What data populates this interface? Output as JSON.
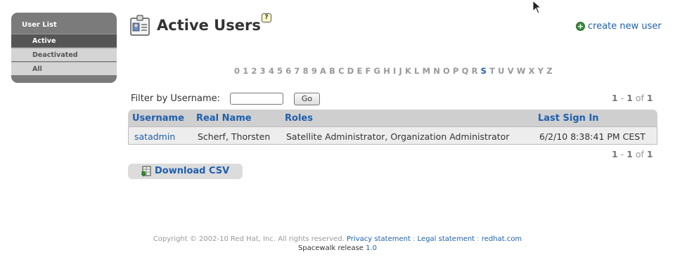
{
  "sidebar": {
    "title": "User List",
    "items": [
      {
        "label": "Active"
      },
      {
        "label": "Deactivated"
      },
      {
        "label": "All"
      }
    ]
  },
  "header": {
    "title": "Active Users",
    "help": "?",
    "create_user": "create new user"
  },
  "alphabet": {
    "letters": [
      "0",
      "1",
      "2",
      "3",
      "4",
      "5",
      "6",
      "7",
      "8",
      "9",
      "A",
      "B",
      "C",
      "D",
      "E",
      "F",
      "G",
      "H",
      "I",
      "J",
      "K",
      "L",
      "M",
      "N",
      "O",
      "P",
      "Q",
      "R",
      "S",
      "T",
      "U",
      "V",
      "W",
      "X",
      "Y",
      "Z"
    ],
    "selected": "S"
  },
  "filter": {
    "label": "Filter by Username:",
    "value": "",
    "go_label": "Go"
  },
  "pager": {
    "start": "1",
    "sep": "-",
    "end": "1",
    "of": "of",
    "total": "1"
  },
  "table": {
    "headers": [
      "Username",
      "Real Name",
      "Roles",
      "Last Sign In"
    ],
    "rows": [
      [
        "satadmin",
        "Scherf, Thorsten",
        "Satellite Administrator, Organization Administrator",
        "6/2/10 8:38:41 PM CEST"
      ]
    ]
  },
  "download": {
    "label": "Download CSV"
  },
  "footer": {
    "copyright": "Copyright © 2002-10 Red Hat, Inc. All rights reserved.",
    "privacy": "Privacy statement",
    "sep": ":",
    "legal": "Legal statement",
    "site": "redhat.com",
    "release_prefix": "Spacewalk release",
    "release_version": "1.0"
  },
  "colors": {
    "link": "#1f5fae",
    "sidebar": "#7b7b7b",
    "sidebar_active": "#555555",
    "table_header": "#cfcfcf"
  }
}
